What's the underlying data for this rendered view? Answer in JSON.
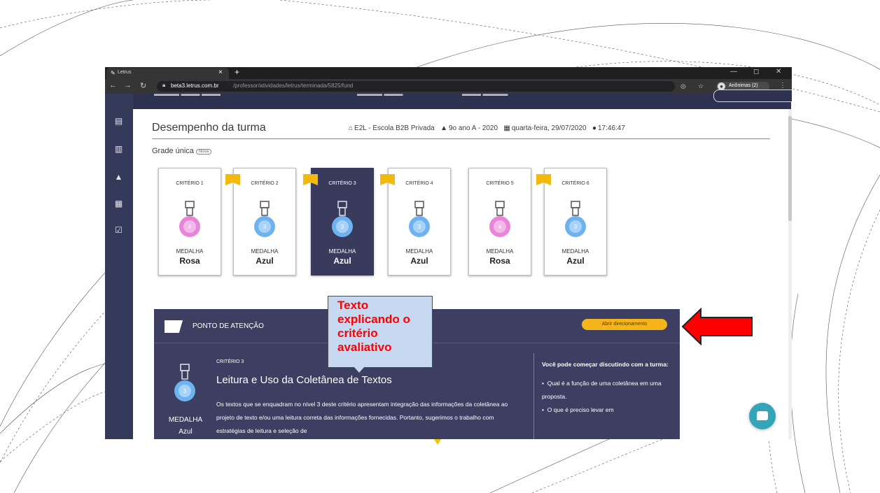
{
  "browser": {
    "tab_title": "Letrus",
    "tab_close": "×",
    "new_tab": "+",
    "url_host": "beta3.letrus.com.br",
    "url_path": "/professor/atividades/letrus/terminada/5825/fund",
    "profile_label": "Anônimas (2)",
    "win_min": "—",
    "win_max": "◻",
    "win_close": "✕"
  },
  "header": {
    "title": "Desempenho da turma",
    "school": "E2L - Escola B2B Privada",
    "class": "9o ano A - 2020",
    "date": "quarta-feira, 29/07/2020",
    "time": "17:46:47"
  },
  "grade": {
    "label": "Grade única",
    "badge": "Nova"
  },
  "criteria": [
    {
      "label": "CRITÉRIO 1",
      "medal_word": "MEDALHA",
      "medal_color_name": "Rosa",
      "level": "4",
      "color": "#e985d8",
      "flag": false,
      "active": false
    },
    {
      "label": "CRITÉRIO 2",
      "medal_word": "MEDALHA",
      "medal_color_name": "Azul",
      "level": "3",
      "color": "#6fb2f0",
      "flag": true,
      "active": false
    },
    {
      "label": "CRITÉRIO 3",
      "medal_word": "MEDALHA",
      "medal_color_name": "Azul",
      "level": "3",
      "color": "#6fb2f0",
      "flag": true,
      "active": true
    },
    {
      "label": "CRITÉRIO 4",
      "medal_word": "MEDALHA",
      "medal_color_name": "Azul",
      "level": "3",
      "color": "#6fb2f0",
      "flag": true,
      "active": false
    },
    {
      "label": "CRITÉRIO 5",
      "medal_word": "MEDALHA",
      "medal_color_name": "Rosa",
      "level": "4",
      "color": "#e985d8",
      "flag": false,
      "active": false
    },
    {
      "label": "CRITÉRIO 6",
      "medal_word": "MEDALHA",
      "medal_color_name": "Azul",
      "level": "3",
      "color": "#6fb2f0",
      "flag": true,
      "active": false
    }
  ],
  "attention": {
    "title": "PONTO DE ATENÇÃO",
    "button": "Abrir direcionamento",
    "criterion": "CRITÉRIO 3",
    "criterion_title": "Leitura e Uso da Coletânea de Textos",
    "description": "Os textos que se enquadram no nível 3 deste critério apresentam integração das informações da coletânea ao projeto de texto e/ou uma leitura correta das informações fornecidas. Portanto, sugerimos o trabalho com estratégias de leitura e seleção de",
    "medal_word": "MEDALHA",
    "medal_color_name": "Azul",
    "medal_level": "3",
    "side_intro": "Você pode começar discutindo com a turma:",
    "side_items": [
      "Qual é a função de uma coletânea em uma proposta.",
      "O que é preciso levar em"
    ]
  },
  "callout": {
    "text": "Texto explicando o critério avaliativo"
  },
  "colors": {
    "sidebar": "#363a5a",
    "panel": "#3c3f61",
    "accent_button": "#f4b41a",
    "flag": "#f2b90f",
    "callout_bg": "#c7d9f0",
    "callout_text": "#ff0000",
    "arrow": "#ff0000",
    "chat": "#34a4b8"
  }
}
